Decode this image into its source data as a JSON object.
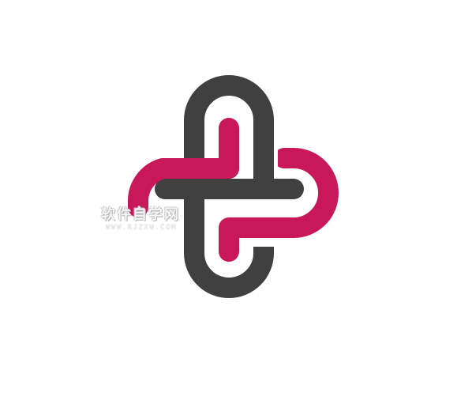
{
  "logo": {
    "colors": {
      "pink": "#c8185a",
      "dark": "#404040",
      "background": "#ffffff"
    }
  },
  "watermark": {
    "title": "软件自学网",
    "url": "WWW.RJZXW.COM"
  }
}
